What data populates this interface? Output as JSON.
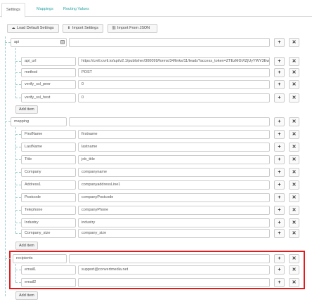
{
  "tabs": [
    {
      "label": "Settings",
      "active": true
    },
    {
      "label": "Mappings",
      "active": false
    },
    {
      "label": "Routing Values",
      "active": false
    }
  ],
  "toolbar": {
    "load_default": "Load Default Settings",
    "import_settings": "Import Settings",
    "import_json": "Import From JSON"
  },
  "groups": {
    "api": {
      "key": "api",
      "value": "",
      "rows": [
        {
          "key": "api_url",
          "value": "https://cvrtl.cvrtl.io/api/v2.1/publisher/300099/forms/34/links/11/leads?access_token=ZTEzMGVlZjUyYWY3Ewi"
        },
        {
          "key": "method",
          "value": "POST"
        },
        {
          "key": "verify_ssl_peer",
          "value": "0"
        },
        {
          "key": "verify_ssl_host",
          "value": "0"
        }
      ],
      "add_label": "Add item"
    },
    "mapping": {
      "key": "mapping",
      "value": "",
      "rows": [
        {
          "key": "FirstName",
          "value": "firstname"
        },
        {
          "key": "LastName",
          "value": "lastname"
        },
        {
          "key": "Title",
          "value": "job_title"
        },
        {
          "key": "Company",
          "value": "companyname"
        },
        {
          "key": "Address1",
          "value": "companyaddressLine1"
        },
        {
          "key": "Postcode",
          "value": "companyPostcode"
        },
        {
          "key": "Telephone",
          "value": "companyPhone"
        },
        {
          "key": "Industry",
          "value": "industry"
        },
        {
          "key": "Company_size",
          "value": "company_size"
        }
      ],
      "add_label": "Add item"
    },
    "recipients": {
      "key": "recipients",
      "value": "",
      "rows": [
        {
          "key": "email1",
          "value": "support@convertmedia.net"
        },
        {
          "key": "email2",
          "value": ""
        }
      ],
      "add_label": "Add item"
    }
  },
  "bottom_add_label": "Add item",
  "icons": {
    "plus": "+",
    "remove": "✕",
    "upload": "⬆",
    "download": "⬇",
    "link": "🔗",
    "type": "▤"
  }
}
